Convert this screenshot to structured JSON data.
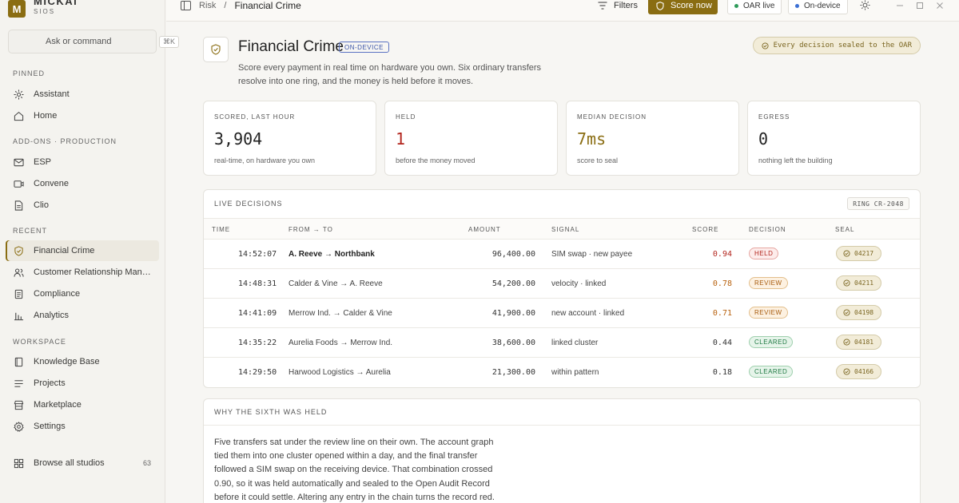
{
  "brand": {
    "name": "MICKAI",
    "sub": "SIOS",
    "logo_letter": "M",
    "accent": "#8a6d12"
  },
  "sidebar": {
    "search_placeholder": "Ask or command",
    "search_shortcut": "⌘K",
    "pinned_label": "PINNED",
    "pinned": [
      {
        "label": "Assistant",
        "icon": "sparkle-icon"
      },
      {
        "label": "Home",
        "icon": "home-icon"
      }
    ],
    "addons_label": "ADD-ONS · PRODUCTION",
    "addons": [
      {
        "label": "ESP",
        "icon": "mail-icon"
      },
      {
        "label": "Convene",
        "icon": "video-icon"
      },
      {
        "label": "Clio",
        "icon": "document-icon"
      }
    ],
    "recent_label": "RECENT",
    "recent": [
      {
        "label": "Financial Crime",
        "icon": "shield-check-icon",
        "active": true
      },
      {
        "label": "Customer Relationship Management",
        "icon": "users-icon"
      },
      {
        "label": "Compliance",
        "icon": "clipboard-icon"
      },
      {
        "label": "Analytics",
        "icon": "bar-chart-icon"
      }
    ],
    "workspace_label": "WORKSPACE",
    "workspace": [
      {
        "label": "Knowledge Base",
        "icon": "book-icon"
      },
      {
        "label": "Projects",
        "icon": "list-icon"
      },
      {
        "label": "Marketplace",
        "icon": "store-icon"
      },
      {
        "label": "Settings",
        "icon": "gear-icon"
      }
    ],
    "browse": {
      "label": "Browse all studios",
      "count": "63"
    }
  },
  "topbar": {
    "breadcrumb_parent": "Risk",
    "breadcrumb_sep": "/",
    "breadcrumb_current": "Financial Crime",
    "filters_label": "Filters",
    "score_now_label": "Score now",
    "oar_live_label": "OAR live",
    "on_device_label": "On-device",
    "status_green": "#2e9b5a",
    "status_blue": "#3b6fd4"
  },
  "header": {
    "title": "Financial Crime",
    "badge": "ON-DEVICE",
    "subtitle": "Score every payment in real time on hardware you own. Six ordinary transfers resolve into one ring, and the money is held before it moves.",
    "sealed_pill": "Every decision sealed to the OAR"
  },
  "kpis": [
    {
      "label": "SCORED, LAST HOUR",
      "value": "3,904",
      "note": "real-time, on hardware you own",
      "color": "#222222"
    },
    {
      "label": "HELD",
      "value": "1",
      "note": "before the money moved",
      "color": "#b3261e"
    },
    {
      "label": "MEDIAN DECISION",
      "value": "7ms",
      "note": "score to seal",
      "color": "#8a6d12"
    },
    {
      "label": "EGRESS",
      "value": "0",
      "note": "nothing left the building",
      "color": "#222222"
    }
  ],
  "live": {
    "title": "LIVE DECISIONS",
    "ring": "RING CR-2048",
    "columns": [
      "TIME",
      "FROM → TO",
      "AMOUNT",
      "SIGNAL",
      "SCORE",
      "DECISION",
      "SEAL"
    ],
    "rows": [
      {
        "time": "14:52:07",
        "from_to": "A. Reeve → Northbank",
        "amount": "96,400.00",
        "signal": "SIM swap · new payee",
        "score": "0.94",
        "decision": "HELD",
        "seal": "04217",
        "score_color": "#b3261e",
        "bold": true
      },
      {
        "time": "14:48:31",
        "from_to": "Calder & Vine → A. Reeve",
        "amount": "54,200.00",
        "signal": "velocity · linked",
        "score": "0.78",
        "decision": "REVIEW",
        "seal": "04211",
        "score_color": "#b8620f"
      },
      {
        "time": "14:41:09",
        "from_to": "Merrow Ind. → Calder & Vine",
        "amount": "41,900.00",
        "signal": "new account · linked",
        "score": "0.71",
        "decision": "REVIEW",
        "seal": "04198",
        "score_color": "#b8620f"
      },
      {
        "time": "14:35:22",
        "from_to": "Aurelia Foods → Merrow Ind.",
        "amount": "38,600.00",
        "signal": "linked cluster",
        "score": "0.44",
        "decision": "CLEARED",
        "seal": "04181",
        "score_color": "#333333"
      },
      {
        "time": "14:29:50",
        "from_to": "Harwood Logistics → Aurelia",
        "amount": "21,300.00",
        "signal": "within pattern",
        "score": "0.18",
        "decision": "CLEARED",
        "seal": "04166",
        "score_color": "#333333"
      }
    ],
    "decision_styles": {
      "HELD": {
        "fg": "#b3261e",
        "bg": "#fdeceb",
        "border": "#e6a7a2"
      },
      "REVIEW": {
        "fg": "#a65a0c",
        "bg": "#fdf1e1",
        "border": "#e3bf8c"
      },
      "CLEARED": {
        "fg": "#1f7a43",
        "bg": "#e6f4ea",
        "border": "#9fd0ae"
      }
    }
  },
  "why": {
    "title": "WHY THE SIXTH WAS HELD",
    "body": "Five transfers sat under the review line on their own. The account graph tied them into one cluster opened within a day, and the final transfer followed a SIM swap on the receiving device. That combination crossed 0.90, so it was held automatically and sealed to the Open Audit Record before it could settle. Altering any entry in the chain turns the record red."
  }
}
